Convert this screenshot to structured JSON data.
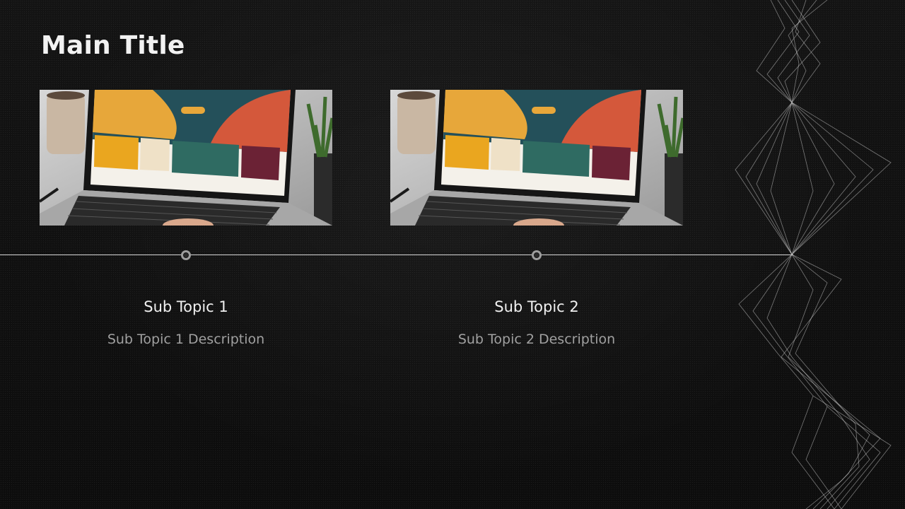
{
  "slide": {
    "title": "Main Title",
    "topics": [
      {
        "title": "Sub Topic 1",
        "description": "Sub Topic 1 Description"
      },
      {
        "title": "Sub Topic 2",
        "description": "Sub Topic 2 Description"
      }
    ]
  },
  "colors": {
    "background": "#111111",
    "title": "#f2f2f2",
    "description": "#a0a0a0",
    "timeline": "#d6d6d6",
    "node": "#9d9d9d"
  },
  "icons": {
    "timeline_node": "ring-node-icon",
    "photo": "laptop-workspace-photo"
  }
}
